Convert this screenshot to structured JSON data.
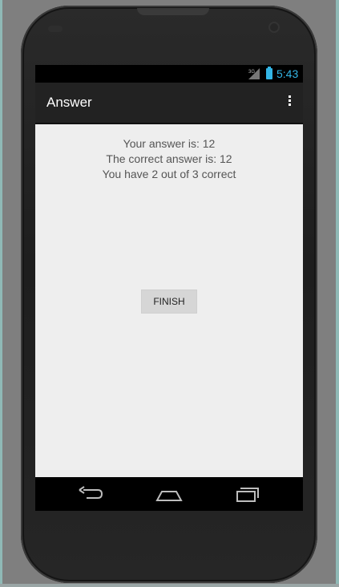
{
  "status_bar": {
    "network": "3G",
    "time": "5:43"
  },
  "action_bar": {
    "title": "Answer"
  },
  "content": {
    "your_answer": "Your answer is: 12",
    "correct_answer": "The correct answer is: 12",
    "score": "You have 2 out of 3 correct",
    "finish_label": "FINISH"
  },
  "icons": {
    "overflow": "overflow-menu-icon",
    "back": "back-icon",
    "home": "home-icon",
    "recents": "recents-icon"
  },
  "colors": {
    "status_accent": "#33b5e5",
    "action_bar": "#222222",
    "content_bg": "#eeeeee",
    "button_bg": "#d6d6d6"
  }
}
